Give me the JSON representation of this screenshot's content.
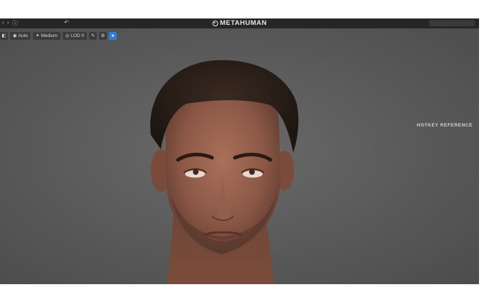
{
  "app": {
    "brand": "METAHUMAN",
    "top_right_button": "",
    "status_lines": [
      "",
      ""
    ]
  },
  "toolbar": {
    "auto_label": "Auto",
    "medium_label": "Medium",
    "lod_label": "LOD 0"
  },
  "hotkey_reference": {
    "title": "HOTKEY REFERENCE",
    "rows": [
      {
        "label": "",
        "key": ""
      },
      {
        "label": "",
        "key": ""
      },
      {
        "label": "",
        "key": ""
      },
      {
        "label": "",
        "key": ""
      },
      {
        "label": "",
        "key": ""
      },
      {
        "label": "",
        "key": ""
      },
      {
        "label": "",
        "key": ""
      },
      {
        "label": "",
        "key": ""
      },
      {
        "label": "",
        "key": ""
      },
      {
        "label": "",
        "key": ""
      },
      {
        "label": "",
        "key": ""
      },
      {
        "label": "",
        "key": ""
      },
      {
        "label": "",
        "key": ""
      },
      {
        "label": "",
        "key": ""
      },
      {
        "label": "",
        "key": ""
      },
      {
        "label": "",
        "key": ""
      },
      {
        "label": "",
        "key": ""
      },
      {
        "label": "",
        "key": ""
      },
      {
        "label": "",
        "key": ""
      },
      {
        "label": "",
        "key": ""
      }
    ]
  },
  "icons": {
    "viewport_content": "head-render"
  }
}
